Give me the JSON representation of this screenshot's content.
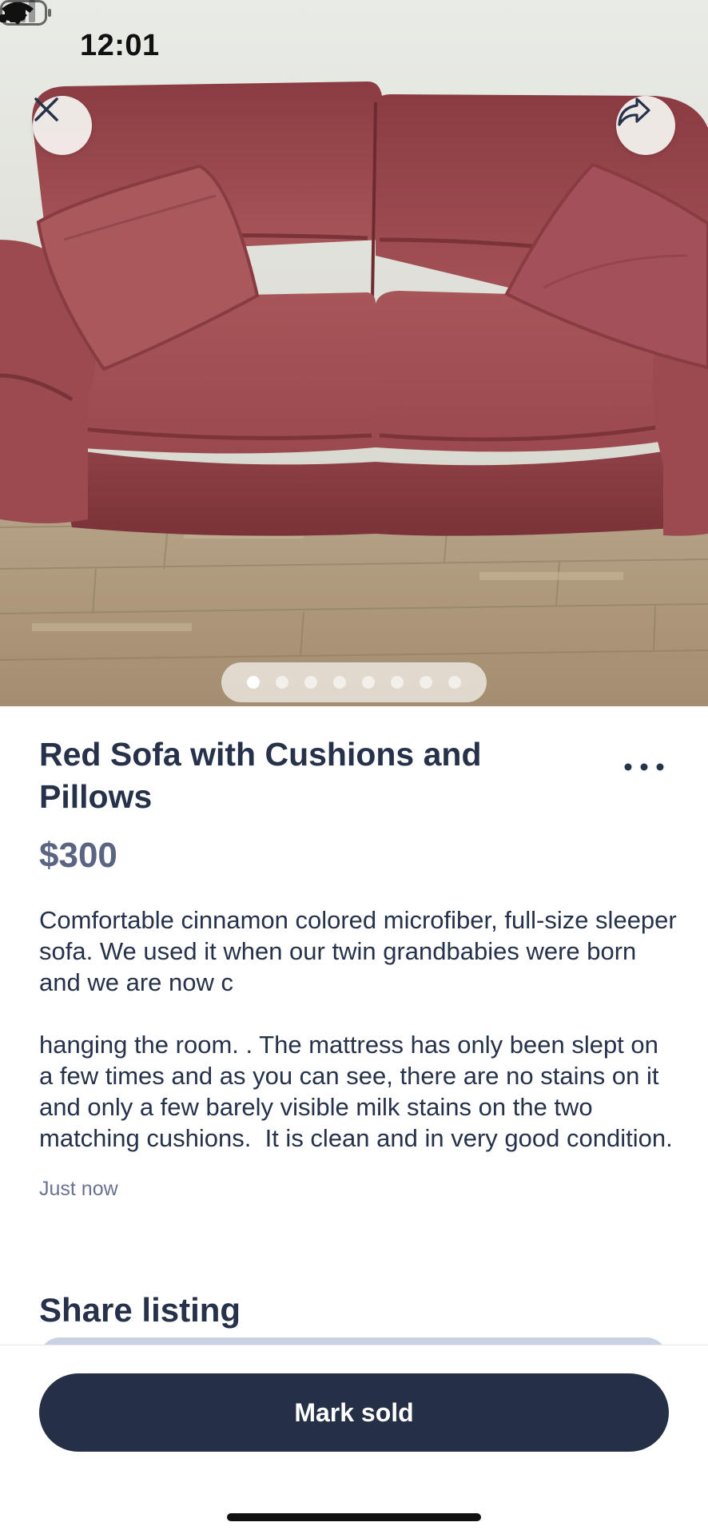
{
  "status_bar": {
    "time": "12:01",
    "icons": [
      "location-arrow-icon",
      "cellular-signal-icon",
      "wifi-icon",
      "battery-icon"
    ]
  },
  "photo": {
    "alt": "Red sofa photo",
    "page_count": 8,
    "current_page": 1
  },
  "listing": {
    "title": "Red Sofa with Cushions and Pillows",
    "price": "$300",
    "description": "Comfortable cinnamon colored microfiber, full-size sleeper sofa. We used it when our twin grandbabies were born and we are now c\n\nhanging the room. . The mattress has only been slept on a few times and as you can see, there are no stains on it and only a few barely visible milk stains on the two matching cushions.  It is clean and in very good condition.",
    "posted": "Just now"
  },
  "share_section": {
    "title": "Share listing"
  },
  "actions": {
    "mark_sold": "Mark sold"
  },
  "colors": {
    "primary_navy": "#252f46",
    "text": "#26314a",
    "price": "#5a6483",
    "muted": "#6a7390"
  }
}
